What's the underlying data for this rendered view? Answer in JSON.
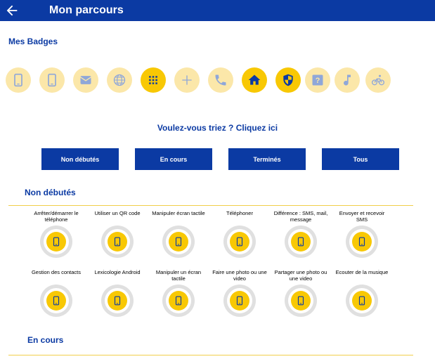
{
  "header": {
    "title": "Mon parcours",
    "back_icon": "arrow-back-icon"
  },
  "badges_section": {
    "title": "Mes Badges",
    "badges": [
      {
        "icon": "tablet-icon",
        "state": "light"
      },
      {
        "icon": "tablet-icon",
        "state": "light"
      },
      {
        "icon": "mail-icon",
        "state": "light"
      },
      {
        "icon": "globe-icon",
        "state": "light"
      },
      {
        "icon": "grid-icon",
        "state": "earned"
      },
      {
        "icon": "plus-icon",
        "state": "light"
      },
      {
        "icon": "phone-icon",
        "state": "light"
      },
      {
        "icon": "home-icon",
        "state": "earned"
      },
      {
        "icon": "shield-icon",
        "state": "earned"
      },
      {
        "icon": "help-icon",
        "state": "light"
      },
      {
        "icon": "music-icon",
        "state": "light"
      },
      {
        "icon": "bike-icon",
        "state": "light"
      }
    ]
  },
  "sort_prompt": "Voulez-vous triez ? Cliquez ici",
  "filters": [
    "Non débutés",
    "En cours",
    "Terminés",
    "Tous"
  ],
  "not_started": {
    "title": "Non débutés",
    "items": [
      "Arrêter/démarrer le téléphone",
      "Utiliser un QR code",
      "Manipuler écran tactile",
      "Téléphoner",
      "Différence : SMS, mail, message",
      "Envoyer et recevoir SMS",
      "Gestion des contacts",
      "Lexicologie Android",
      "Manipuler un écran tactile",
      "Faire une photo ou une video",
      "Partager une photo ou une video",
      "Ecouter de la musique"
    ]
  },
  "in_progress": {
    "title": "En cours"
  },
  "colors": {
    "primary": "#0b3aa3",
    "accent": "#f8c804",
    "accent_light": "#fbe7a9",
    "ring": "#e0e0e0"
  }
}
